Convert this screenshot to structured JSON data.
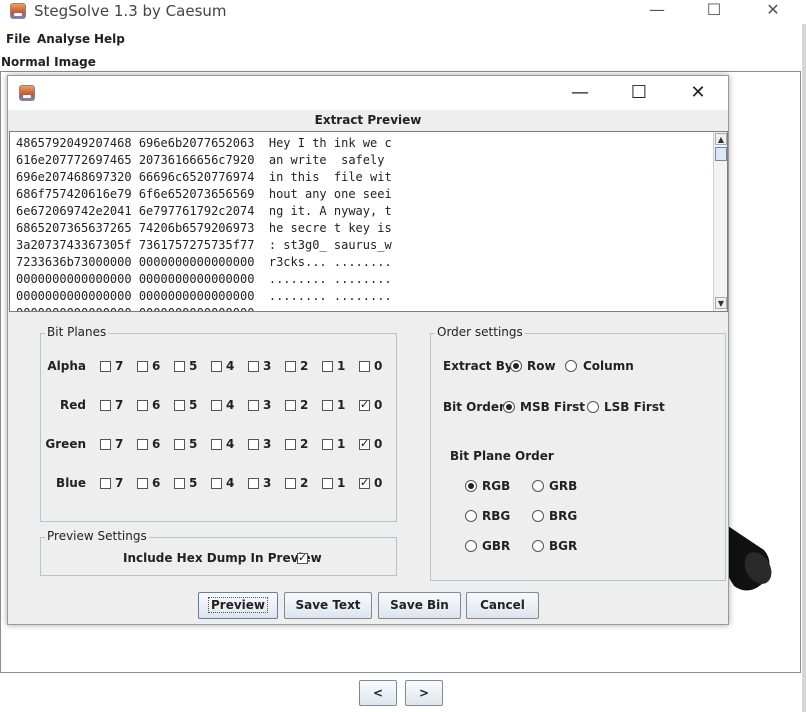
{
  "app": {
    "title": "StegSolve 1.3 by Caesum"
  },
  "menu": [
    "File",
    "Analyse",
    "Help"
  ],
  "main": {
    "label": "Normal Image",
    "prev": "<",
    "next": ">"
  },
  "dialog": {
    "heading": "Extract Preview",
    "preview_lines": [
      "4865792049207468 696e6b2077652063  Hey I th ink we c",
      "616e207772697465 20736166656c7920  an write  safely ",
      "696e207468697320 66696c6520776974  in this  file wit",
      "686f757420616e79 6f6e652073656569  hout any one seei",
      "6e672069742e2041 6e797761792c2074  ng it. A nyway, t",
      "6865207365637265 74206b6579206973  he secre t key is",
      "3a2073743367305f 7361757275735f77  : st3g0_ saurus_w",
      "7233636b73000000 0000000000000000  r3cks... ........",
      "0000000000000000 0000000000000000  ........ ........",
      "0000000000000000 0000000000000000  ........ ........",
      "0000000000000000 0000000000000000  ........ ........"
    ],
    "bit_planes": {
      "title": "Bit Planes",
      "bits": [
        "7",
        "6",
        "5",
        "4",
        "3",
        "2",
        "1",
        "0"
      ],
      "rows": [
        {
          "name": "Alpha",
          "checked": []
        },
        {
          "name": "Red",
          "checked": [
            "0"
          ]
        },
        {
          "name": "Green",
          "checked": [
            "0"
          ]
        },
        {
          "name": "Blue",
          "checked": [
            "0"
          ]
        }
      ]
    },
    "preview_settings": {
      "title": "Preview Settings",
      "include_hex_label": "Include Hex Dump In Preview",
      "include_hex": true
    },
    "order_settings": {
      "title": "Order settings",
      "extract_by_label": "Extract By",
      "extract_by_options": [
        "Row",
        "Column"
      ],
      "extract_by": "Row",
      "bit_order_label": "Bit Order",
      "bit_order_options": [
        "MSB First",
        "LSB First"
      ],
      "bit_order": "MSB First",
      "plane_order_label": "Bit Plane Order",
      "plane_order_options": [
        "RGB",
        "GRB",
        "RBG",
        "BRG",
        "GBR",
        "BGR"
      ],
      "plane_order": "RGB"
    },
    "buttons": {
      "preview": "Preview",
      "save_text": "Save Text",
      "save_bin": "Save Bin",
      "cancel": "Cancel"
    }
  }
}
